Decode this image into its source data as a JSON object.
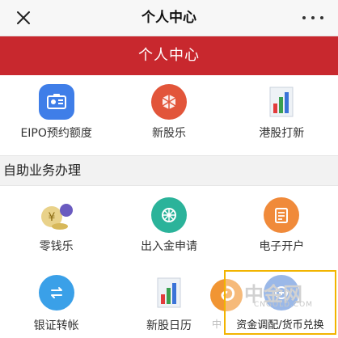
{
  "topbar": {
    "title": "个人中心",
    "close_icon": "close-icon",
    "more_icon": "more-icon"
  },
  "banner": {
    "title": "个人中心"
  },
  "quick_row": [
    {
      "label": "EIPO预约额度",
      "icon": "id-card-icon",
      "color": "#3f7ee8"
    },
    {
      "label": "新股乐",
      "icon": "cube-icon",
      "color": "#e2553a"
    },
    {
      "label": "港股打新",
      "icon": "bar-chart-icon",
      "color": "#3a8fd8"
    }
  ],
  "section": {
    "title": "自助业务办理"
  },
  "services_row1": [
    {
      "label": "零钱乐",
      "icon": "money-bag-icon",
      "color": "#c9a53a"
    },
    {
      "label": "出入金申请",
      "icon": "wheel-icon",
      "color": "#2bb39a"
    },
    {
      "label": "电子开户",
      "icon": "document-icon",
      "color": "#f08a3a"
    }
  ],
  "services_row2": [
    {
      "label": "银证转帐",
      "icon": "transfer-arrows-icon",
      "color": "#3aa0e8"
    },
    {
      "label": "新股日历",
      "icon": "bar-chart-icon",
      "color": "#3a8fd8"
    },
    {
      "label": "资金调配/货币兑换",
      "icon": "exchange-icon",
      "color": "#4a7fd6"
    }
  ],
  "watermark": {
    "text": "中金网",
    "subtext": "CNGOLD.COM",
    "obscured_label": "中"
  }
}
